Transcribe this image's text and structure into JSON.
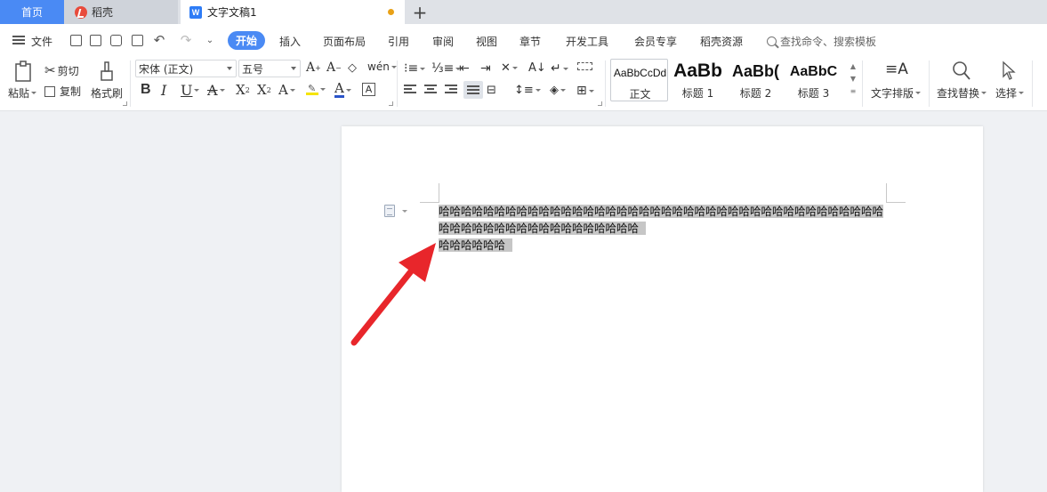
{
  "tabs": {
    "home": "首页",
    "daoke": "稻壳",
    "document": "文字文稿1",
    "add": "+"
  },
  "menu": {
    "file": "文件",
    "items": [
      "开始",
      "插入",
      "页面布局",
      "引用",
      "审阅",
      "视图",
      "章节",
      "开发工具",
      "会员专享",
      "稻壳资源"
    ],
    "search_placeholder": "查找命令、搜索模板"
  },
  "ribbon": {
    "paste": "粘贴",
    "cut": "剪切",
    "copy": "复制",
    "format_painter": "格式刷",
    "font_name": "宋体 (正文)",
    "font_size": "五号",
    "styles": [
      {
        "sample": "AaBbCcDd",
        "name": "正文"
      },
      {
        "sample": "AaBb",
        "name": "标题 1"
      },
      {
        "sample": "AaBb(",
        "name": "标题 2"
      },
      {
        "sample": "AaBbC",
        "name": "标题 3"
      }
    ],
    "text_layout": "文字排版",
    "find_replace": "查找替换",
    "select": "选择"
  },
  "document": {
    "lines": [
      "哈哈哈哈哈哈哈哈哈哈哈哈哈哈哈哈哈哈哈哈哈哈哈哈哈哈哈哈哈哈哈哈哈哈哈哈哈哈哈哈",
      "哈哈哈哈哈哈哈哈哈哈哈哈哈哈哈哈哈哈",
      "哈哈哈哈哈哈"
    ]
  },
  "colors": {
    "accent": "#4a8af4",
    "selection": "#c6c6c6",
    "arrow": "#e8262b"
  }
}
